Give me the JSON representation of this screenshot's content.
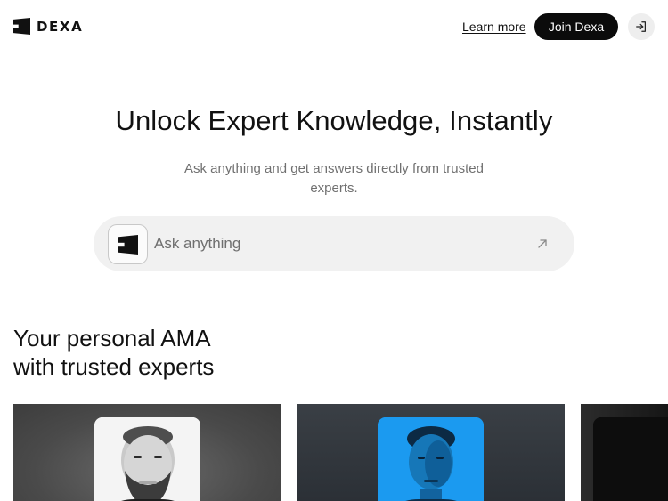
{
  "brand": {
    "name": "DEXA",
    "logo_icon": "dexa-logo-icon"
  },
  "header": {
    "learn_more_label": "Learn more",
    "join_label": "Join Dexa",
    "signin_icon": "sign-in-icon"
  },
  "hero": {
    "title": "Unlock Expert Knowledge, Instantly",
    "subtitle": "Ask anything and get answers directly from trusted experts."
  },
  "search": {
    "placeholder": "Ask anything",
    "value": "",
    "submit_icon": "arrow-up-right-icon"
  },
  "experts_section": {
    "title_line_1": "Your personal AMA",
    "title_line_2": "with trusted experts"
  },
  "colors": {
    "primary_button": "#0b0b0b",
    "search_background": "#f1f1f1",
    "muted_text": "#707070",
    "card_2_portrait_background": "#1b9af0"
  }
}
